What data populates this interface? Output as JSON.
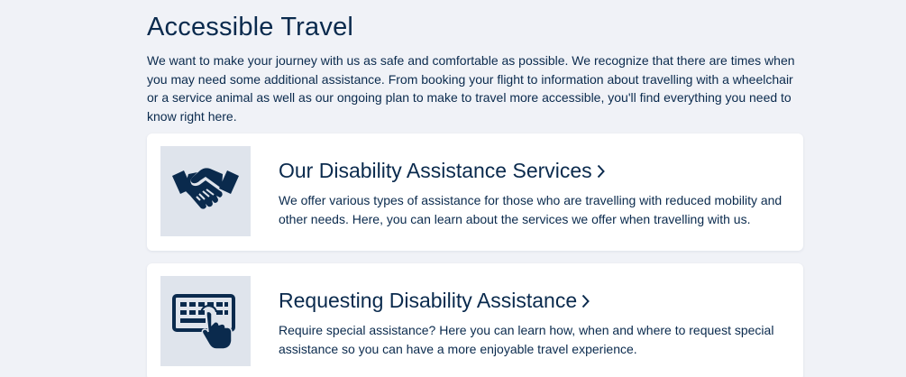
{
  "page": {
    "title": "Accessible Travel",
    "intro": "We want to make your journey with us as safe and comfortable as possible. We recognize that there are times when you may need some additional assistance. From booking your flight to information about travelling with a wheelchair or a service animal as well as our ongoing plan to make to travel more accessible, you'll find everything you need to know right here."
  },
  "cards": [
    {
      "icon": "handshake-icon",
      "title": "Our Disability Assistance Services",
      "description": "We offer various types of assistance for those who are travelling with reduced mobility and other needs. Here, you can learn about the services we offer when travelling with us."
    },
    {
      "icon": "keyboard-touch-icon",
      "title": "Requesting Disability Assistance",
      "description": "Require special assistance? Here you can learn how, when and where to request special assistance so you can have a more enjoyable travel experience."
    }
  ],
  "colors": {
    "background": "#f0f2f7",
    "primary_text": "#0a2a4d",
    "card_background": "#ffffff",
    "icon_tile": "#dfe4ec"
  }
}
